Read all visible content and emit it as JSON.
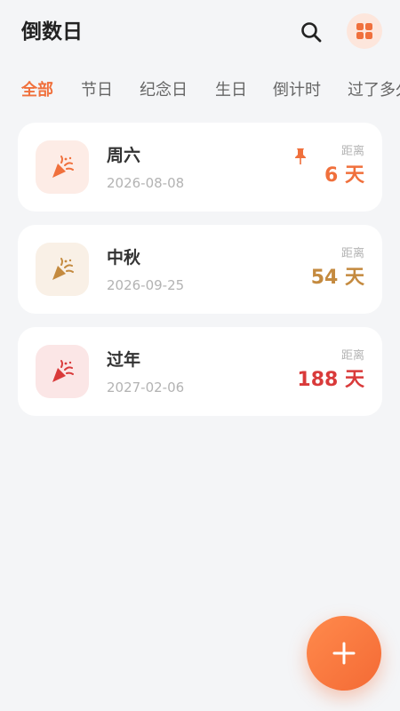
{
  "header": {
    "title": "倒数日",
    "search_icon": "search-icon",
    "grid_icon": "grid-icon"
  },
  "tabs": [
    {
      "label": "全部",
      "active": true
    },
    {
      "label": "节日",
      "active": false
    },
    {
      "label": "纪念日",
      "active": false
    },
    {
      "label": "生日",
      "active": false
    },
    {
      "label": "倒计时",
      "active": false
    },
    {
      "label": "过了多久",
      "active": false
    }
  ],
  "events": [
    {
      "name": "周六",
      "date": "2026-08-08",
      "label": "距离",
      "days": "6 天",
      "pinned": true,
      "color": "#f0703c",
      "icon_bg": "#fdece6",
      "icon": "party-popper-icon"
    },
    {
      "name": "中秋",
      "date": "2026-09-25",
      "label": "距离",
      "days": "54 天",
      "pinned": false,
      "color": "#c48a3f",
      "icon_bg": "#f9f0e6",
      "icon": "party-popper-icon"
    },
    {
      "name": "过年",
      "date": "2027-02-06",
      "label": "距离",
      "days": "188 天",
      "pinned": false,
      "color": "#d93a3a",
      "icon_bg": "#fbe6e6",
      "icon": "party-popper-icon"
    }
  ],
  "fab": {
    "icon": "plus-icon",
    "color": "#f46a35"
  }
}
